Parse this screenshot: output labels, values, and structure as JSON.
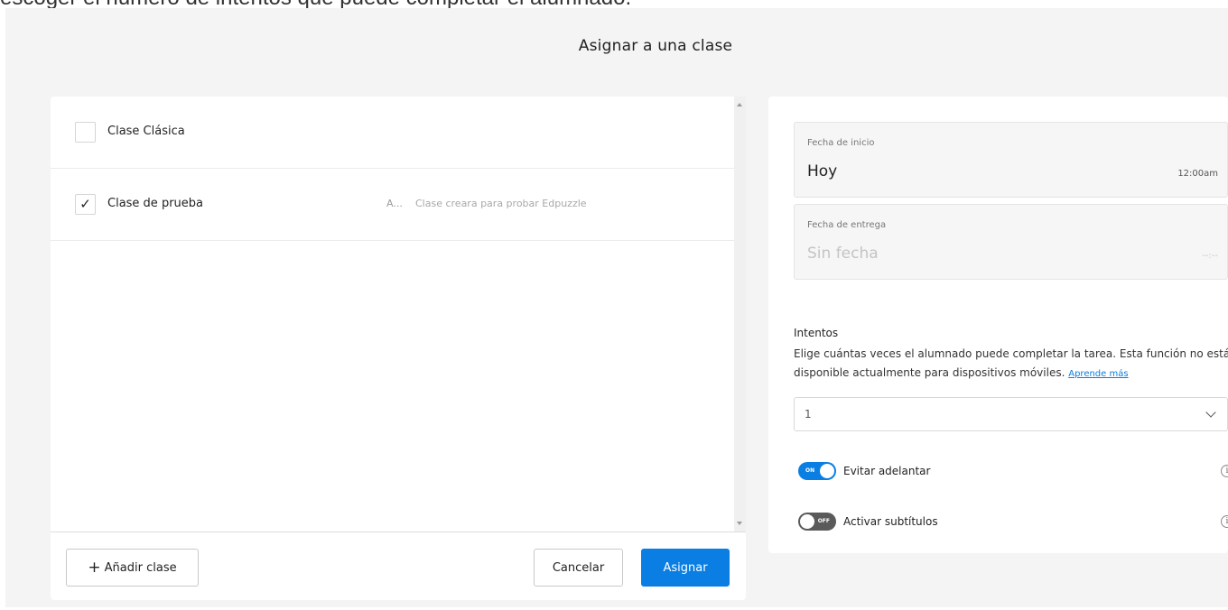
{
  "page_caption": "escoger el número de intentos que puede completar el alumnado.",
  "modal": {
    "title": "Asignar a una clase"
  },
  "classes": [
    {
      "name": "Clase Clásica",
      "checked": false,
      "check_glyph": "",
      "code": "",
      "description": ""
    },
    {
      "name": "Clase de prueba",
      "checked": true,
      "check_glyph": "✓",
      "code": "A...",
      "description": "Clase creara para probar Edpuzzle"
    }
  ],
  "footer": {
    "add_class_plus": "+",
    "add_class_label": "Añadir clase",
    "cancel_label": "Cancelar",
    "assign_label": "Asignar"
  },
  "schedule": {
    "start": {
      "label": "Fecha de inicio",
      "value": "Hoy",
      "time": "12:00am"
    },
    "due": {
      "label": "Fecha de entrega",
      "value": "Sin fecha",
      "time": "--:--"
    }
  },
  "attempts": {
    "title": "Intentos",
    "description": "Elige cuántas veces el alumnado puede completar la tarea. Esta función no está disponible actualmente para dispositivos móviles.",
    "learn_more": "Aprende más",
    "selected": "1"
  },
  "toggles": {
    "prevent_skipping": {
      "label": "Evitar adelantar",
      "state": "ON"
    },
    "subtitles": {
      "label": "Activar subtítulos",
      "state": "OFF"
    }
  },
  "icons": {
    "checkmark": "checkmark-icon",
    "plus": "plus-icon",
    "chevron": "chevron-down-icon",
    "info": "info-icon",
    "info_glyph": "i"
  },
  "colors": {
    "primary": "#0a7ee2",
    "toggle_off": "#5a5a5a",
    "modal_bg": "#f4f4f4"
  }
}
